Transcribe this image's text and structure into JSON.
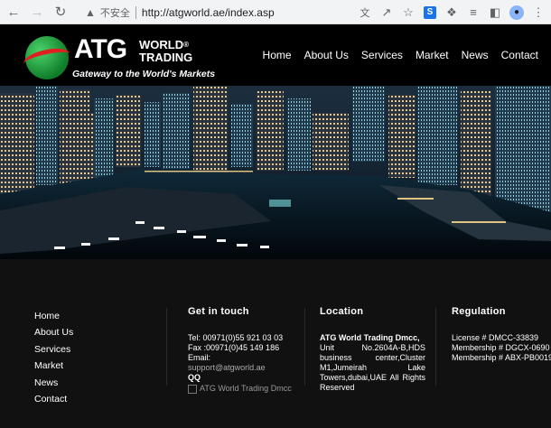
{
  "browser": {
    "security_label": "不安全",
    "url": "http://atgworld.ae/index.asp",
    "icons": [
      "back-icon",
      "forward-icon",
      "reload-icon",
      "warning-icon",
      "translate-icon",
      "share-icon",
      "star-icon",
      "extension-s-icon",
      "puzzle-icon",
      "reading-list-icon",
      "sidebar-icon",
      "profile-icon",
      "menu-icon"
    ]
  },
  "logo": {
    "brand": "ATG",
    "world": "WORLD",
    "trading": "TRADING",
    "reg_mark": "®",
    "tagline": "Gateway to the World's Markets"
  },
  "nav": {
    "items": [
      {
        "label": "Home"
      },
      {
        "label": "About Us"
      },
      {
        "label": "Services"
      },
      {
        "label": "Market"
      },
      {
        "label": "News"
      },
      {
        "label": "Contact"
      }
    ]
  },
  "footer": {
    "links": [
      {
        "label": "Home"
      },
      {
        "label": "About Us"
      },
      {
        "label": "Services"
      },
      {
        "label": "Market"
      },
      {
        "label": "News"
      },
      {
        "label": "Contact"
      }
    ],
    "contact": {
      "heading": "Get in touch",
      "tel": "Tel: 00971(0)55 921 03 03",
      "fax": "Fax :00971(0)45 149 186",
      "email_label": "Email:",
      "email": "support@atgworld.ae",
      "qq_label": "QQ",
      "image_alt": "ATG World Trading Dmcc"
    },
    "location": {
      "heading": "Location",
      "company": "ATG World Trading Dmcc,",
      "address": "Unit No.2604A-B,HDS business center,Cluster M1,Jumeirah Lake Towers,dubai,UAE All Rights Reserved"
    },
    "regulation": {
      "heading": "Regulation",
      "license": "License # DMCC-33839",
      "membership1": "Membership # DGCX-0690",
      "membership2": "Membership # ABX-PB0019"
    }
  },
  "colors": {
    "header_bg": "#000000",
    "footer_bg": "#111111",
    "logo_green": "#1a9a3a",
    "logo_red": "#e02020",
    "text": "#ffffff"
  }
}
